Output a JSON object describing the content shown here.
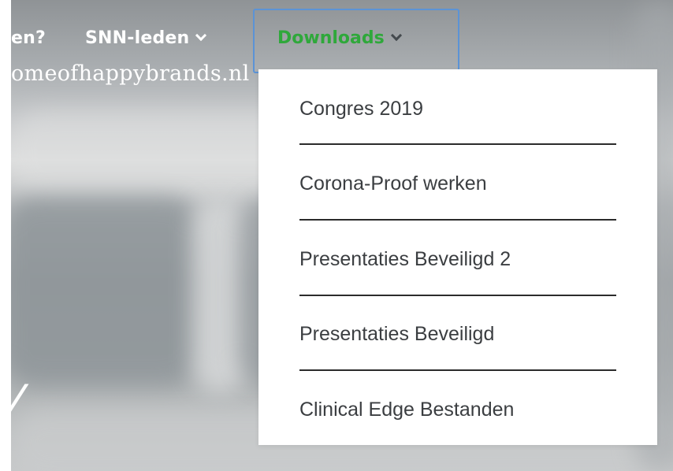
{
  "nav": {
    "prev_label": "en?",
    "leden_label": "SNN-leden",
    "downloads_label": "Downloads"
  },
  "brand_text": "omeofhappybrands.nl",
  "hero_glyph": "/",
  "dropdown": {
    "items": [
      {
        "label": "Congres 2019"
      },
      {
        "label": "Corona-Proof werken"
      },
      {
        "label": "Presentaties Beveiligd 2"
      },
      {
        "label": "Presentaties Beveiligd"
      },
      {
        "label": "Clinical Edge Bestanden"
      }
    ]
  },
  "colors": {
    "active_nav": "#2fa83b",
    "focus_outline": "#5b93d6",
    "menu_text": "#3b3e41",
    "separator": "#2b2b2b"
  },
  "icons": {
    "leden_chevron": "chevron-down-icon",
    "downloads_chevron": "chevron-down-icon"
  }
}
